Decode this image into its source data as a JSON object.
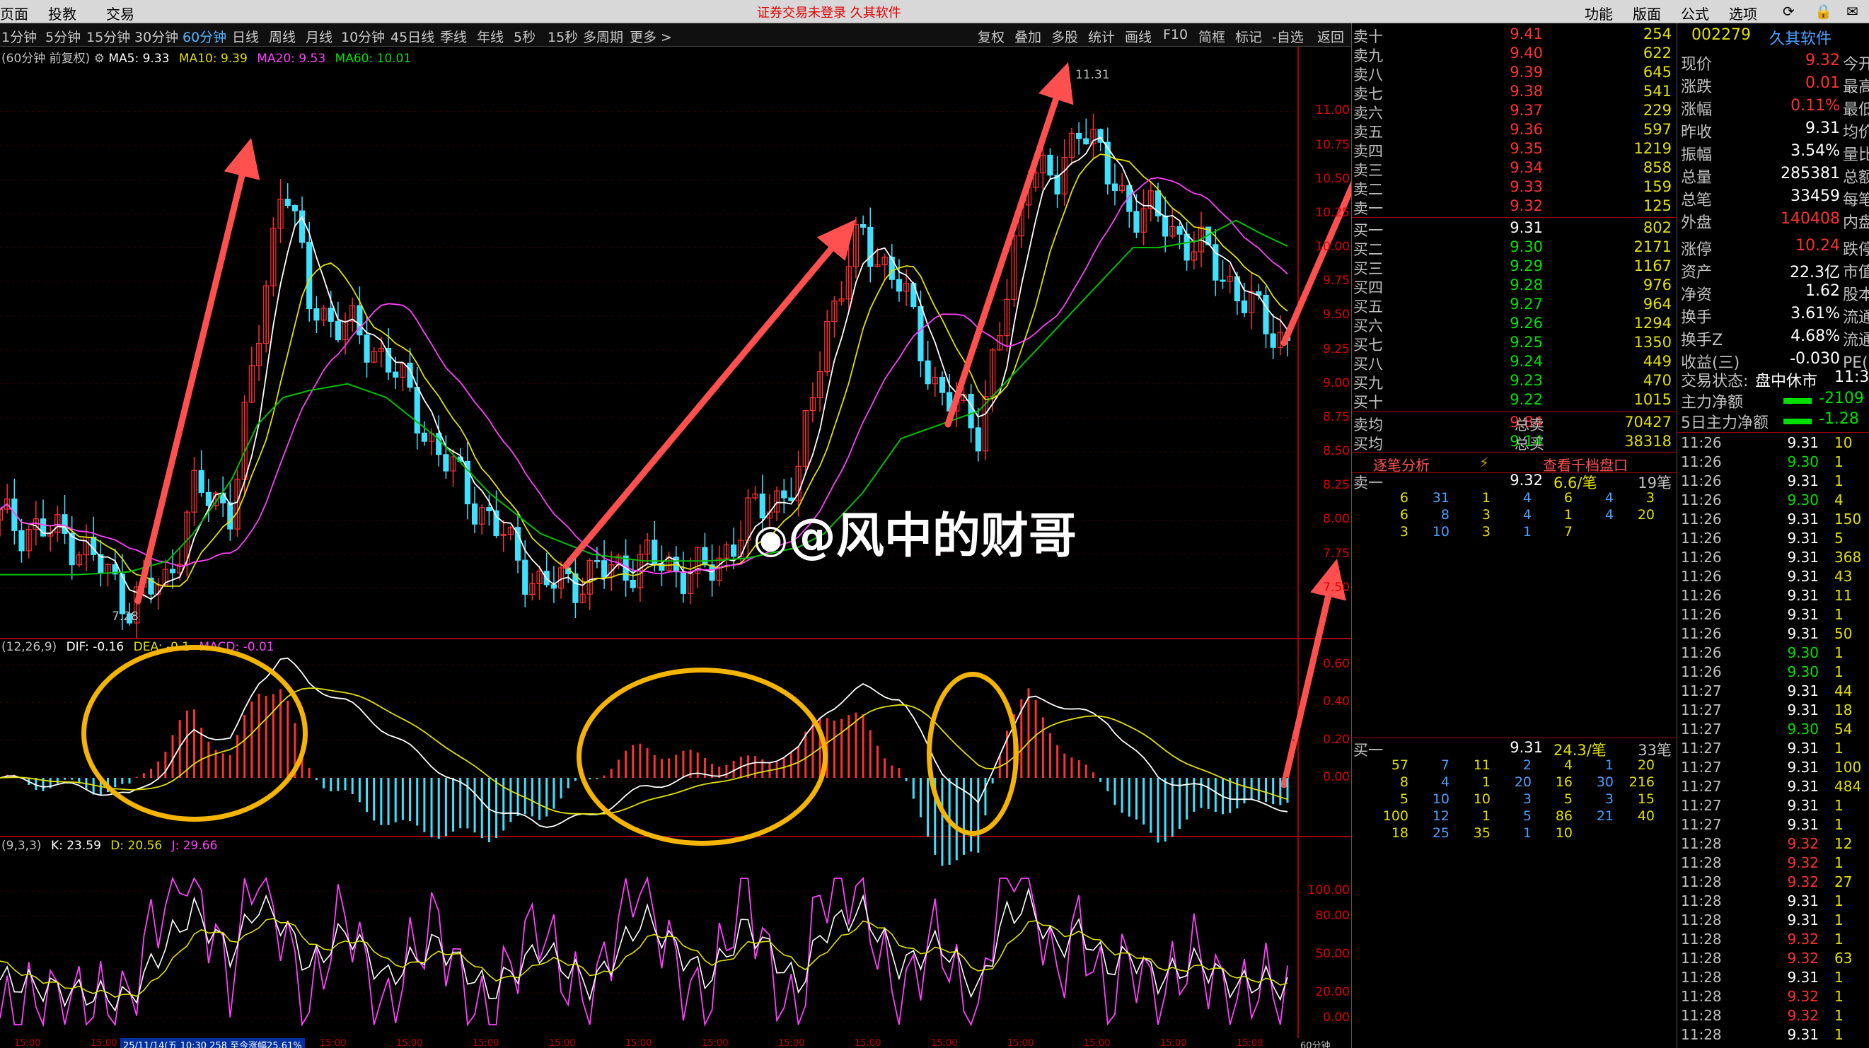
{
  "menubar": {
    "left": [
      "页面",
      "投教",
      "交易"
    ],
    "notice": "证券交易未登录  久其软件",
    "right": [
      "功能",
      "版面",
      "公式",
      "选项"
    ]
  },
  "periods": [
    "1分钟",
    "5分钟",
    "15分钟",
    "30分钟",
    "60分钟",
    "日线",
    "周线",
    "月线",
    "10分钟",
    "45日线",
    "季线",
    "年线",
    "5秒",
    "15秒",
    "多周期",
    "更多 >"
  ],
  "active_period": "60分钟",
  "toolbar": [
    "复权",
    "叠加",
    "多股",
    "统计",
    "画线",
    "F10",
    "简框",
    "标记",
    "-自选",
    "返回"
  ],
  "ma_header": {
    "prefix": "(60分钟 前复权)",
    "ma5": "MA5: 9.33",
    "ma10": "MA10: 9.39",
    "ma20": "MA20: 9.53",
    "ma60": "MA60: 10.01"
  },
  "macd_header": {
    "prefix": "(12,26,9)",
    "dif": "DIF: -0.16",
    "dea": "DEA: -0.1",
    "macd": "MACD: -0.01"
  },
  "kdj_header": {
    "prefix": "(9,3,3)",
    "k": "K: 23.59",
    "d": "D: 20.56",
    "j": "J: 29.66"
  },
  "price_axis": [
    "11.00",
    "10.75",
    "10.50",
    "10.25",
    "10.00",
    "9.75",
    "9.50",
    "9.25",
    "9.00",
    "8.75",
    "8.50",
    "8.25",
    "8.00",
    "7.75",
    "7.50"
  ],
  "macd_axis": [
    "0.60",
    "0.40",
    "0.20",
    "0.00"
  ],
  "kdj_axis": [
    "100.00",
    "80.00",
    "50.00",
    "20.00",
    "0.00"
  ],
  "annotations": {
    "high": "11.31",
    "low": "7.28"
  },
  "bottom_axis": {
    "ticks": [
      "15:00",
      "15:00",
      "15:00",
      "15:00",
      "15:00",
      "15:00",
      "15:00",
      "15:00",
      "15:00",
      "15:00",
      "15:00",
      "15:00",
      "15:00",
      "15:00",
      "15:00",
      "15:00",
      "15:00"
    ],
    "cursor_info": "25/11/14(五 10:30 258 至今涨幅25.61%",
    "period": "60分钟"
  },
  "watermark": "@风中的财哥",
  "chart_data": {
    "type": "candlestick",
    "title": "",
    "price_range": [
      7.25,
      11.35
    ],
    "price_path_x": [
      0,
      0.06,
      0.1,
      0.13,
      0.15,
      0.18,
      0.2,
      0.22,
      0.24,
      0.27,
      0.3,
      0.34,
      0.38,
      0.42,
      0.46,
      0.5,
      0.55,
      0.58,
      0.62,
      0.64,
      0.67,
      0.7,
      0.73,
      0.76,
      0.78,
      0.8,
      0.82,
      0.84,
      0.86,
      0.88,
      0.9,
      0.93,
      0.96,
      0.98,
      1.0
    ],
    "price_path_y": [
      8.0,
      7.85,
      7.4,
      7.55,
      8.2,
      8.1,
      9.3,
      10.6,
      9.6,
      9.4,
      9.2,
      8.5,
      8.0,
      7.5,
      7.6,
      7.7,
      7.6,
      8.0,
      8.3,
      9.4,
      10.1,
      9.7,
      8.9,
      8.7,
      9.5,
      10.7,
      10.4,
      11.0,
      10.5,
      10.3,
      10.2,
      10.0,
      9.7,
      9.45,
      9.32
    ],
    "ma60_y": [
      7.6,
      7.6,
      7.62,
      7.7,
      7.9,
      8.3,
      8.7,
      8.9,
      8.95,
      9.0,
      8.9,
      8.6,
      8.2,
      7.9,
      7.75,
      7.7,
      7.7,
      7.72,
      7.8,
      7.9,
      8.2,
      8.6,
      8.7,
      8.8,
      9.0,
      9.2,
      9.4,
      9.6,
      9.8,
      10.0,
      10.0,
      10.05,
      10.2,
      10.1,
      10.01
    ],
    "dif": [
      0.0,
      -0.05,
      -0.1,
      0.05,
      0.25,
      0.2,
      0.5,
      0.65,
      0.5,
      0.4,
      0.25,
      0.05,
      -0.15,
      -0.25,
      -0.2,
      -0.05,
      0.02,
      0.05,
      0.15,
      0.35,
      0.48,
      0.42,
      0.05,
      -0.15,
      0.2,
      0.42,
      0.4,
      0.35,
      0.3,
      0.15,
      0.0,
      -0.05,
      -0.1,
      -0.15,
      -0.16
    ],
    "kdj_k": [
      30,
      20,
      15,
      60,
      85,
      50,
      90,
      75,
      40,
      70,
      30,
      60,
      20,
      55,
      25,
      80,
      30,
      75,
      25,
      70,
      85,
      40,
      60,
      20,
      80,
      90,
      55,
      70,
      40,
      50,
      30,
      45,
      25,
      30,
      23.59
    ],
    "macd_circles": 3
  }
}
